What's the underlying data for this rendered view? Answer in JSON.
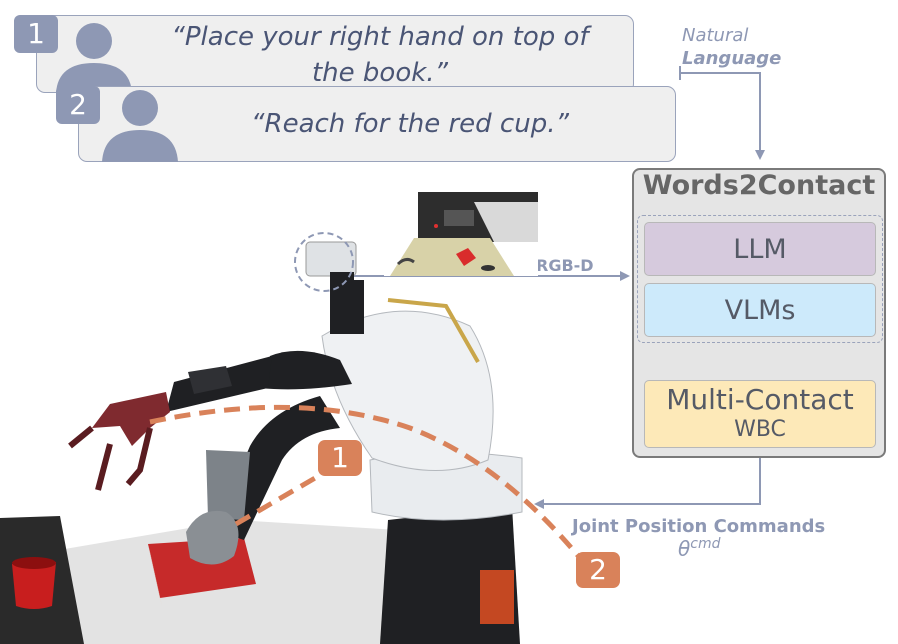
{
  "instructions": [
    {
      "number": "1",
      "text": "“Place your right hand on top of the book.”"
    },
    {
      "number": "2",
      "text": "“Reach for the red cup.”"
    }
  ],
  "input_label": {
    "line1": "Natural",
    "line2": "Language"
  },
  "panel": {
    "title": "Words2Contact",
    "llm": "LLM",
    "vlms": "VLMs",
    "wbc_line1": "Multi-Contact",
    "wbc_line2": "WBC"
  },
  "rgbd_label": "RGB-D",
  "output_label": {
    "line1": "Joint Position Commands",
    "symbol": "θ",
    "superscript": "cmd"
  },
  "trajectory_markers": [
    "1",
    "2"
  ],
  "colors": {
    "accent": "#8e98b4",
    "bubble_text": "#4a5575",
    "llm_fill": "#d6cadd",
    "vlm_fill": "#cdeafb",
    "wbc_fill": "#fde9b8",
    "trajectory": "#d9825a",
    "robot_white": "#e9ecef",
    "robot_dark": "#1f2023"
  }
}
